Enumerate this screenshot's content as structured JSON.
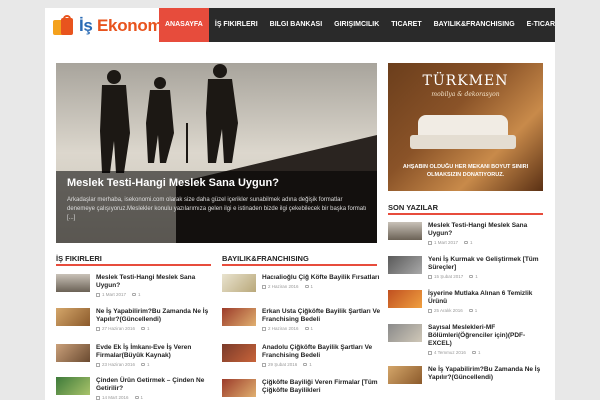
{
  "site": {
    "logo_text_1": "İş ",
    "logo_text_2": "Ekonomi"
  },
  "nav": [
    {
      "label": "ANASAYFA",
      "active": true
    },
    {
      "label": "İŞ FIKIRLERI"
    },
    {
      "label": "BILGI BANKASI"
    },
    {
      "label": "GIRIŞIMCILIK"
    },
    {
      "label": "TICARET"
    },
    {
      "label": "BAYILIK&FRANCHISING"
    },
    {
      "label": "E-TICARET"
    }
  ],
  "hero": {
    "title": "Meslek Testi-Hangi Meslek Sana Uygun?",
    "excerpt": "Arkadaşlar merhaba, isekonomi.com olarak size daha güzel içerikler sunabilmek adına değişik formatlar denemeye çalışıyoruz.Meslekler konulu yazılarımıza gelen ilgi e istinaden bizde ilgi çekebilecek bir başka formatı [...]"
  },
  "ad": {
    "brand": "TÜRKMEN",
    "tagline": "mobilya & dekorasyon",
    "text": "AHŞABIN OLDUĞU HER MEKANI BOYUT SINIRI OLMAKSIZIN DONATIYORUZ."
  },
  "sections": {
    "is_fikirleri": {
      "title": "İŞ FIKIRLERI",
      "items": [
        {
          "title": "Meslek Testi-Hangi Meslek Sana Uygun?",
          "date": "1 Mart 2017",
          "comments": "1"
        },
        {
          "title": "Ne İş Yapabilirim?Bu Zamanda Ne İş Yapılır?(Güncellendi)",
          "date": "27 Haziran 2016",
          "comments": "1"
        },
        {
          "title": "Evde Ek İş İmkanı-Eve İş Veren Firmalar(Büyük Kaynak)",
          "date": "23 Haziran 2016",
          "comments": "1"
        },
        {
          "title": "Çinden Ürün Getirmek – Çinden Ne Getirilir?",
          "date": "14 Mart 2016",
          "comments": "1"
        }
      ]
    },
    "bayilik": {
      "title": "BAYILIK&FRANCHISING",
      "items": [
        {
          "title": "Hacıalioğlu Çiğ Köfte Bayilik Fırsatları",
          "date": "2 Haziran 2016",
          "comments": "1"
        },
        {
          "title": "Erkan Usta Çiğköfte Bayilik Şartları Ve Franchising Bedeli",
          "date": "2 Haziran 2016",
          "comments": "1"
        },
        {
          "title": "Anadolu Çiğköfte Bayilik Şartları Ve Franchising Bedeli",
          "date": "29 Şubat 2016",
          "comments": "1"
        },
        {
          "title": "Çiğköfte Bayiliği Veren Firmalar [Tüm Çiğköfte Bayilikleri",
          "date": "",
          "comments": ""
        }
      ]
    },
    "son_yazilar": {
      "title": "SON YAZILAR",
      "items": [
        {
          "title": "Meslek Testi-Hangi Meslek Sana Uygun?",
          "date": "1 Mart 2017",
          "comments": "1"
        },
        {
          "title": "Yeni İş Kurmak ve Geliştirmek [Tüm Süreçler]",
          "date": "15 Şubat 2017",
          "comments": "1"
        },
        {
          "title": "İşyerine Mutlaka Alınan 6 Temizlik Ürünü",
          "date": "25 Aralık 2016",
          "comments": "1"
        },
        {
          "title": "Sayısal Meslekleri-MF Bölümleri(Öğrenciler için)(PDF-EXCEL)",
          "date": "4 Temmuz 2016",
          "comments": "1"
        },
        {
          "title": "Ne İş Yapabilirim?Bu Zamanda Ne İş Yapılır?(Güncellendi)",
          "date": "",
          "comments": ""
        }
      ]
    }
  },
  "colors": {
    "accent": "#e74c3c",
    "nav_bg": "#2a2a2a",
    "logo_orange": "#e8541e",
    "logo_blue": "#2a6bb5"
  }
}
